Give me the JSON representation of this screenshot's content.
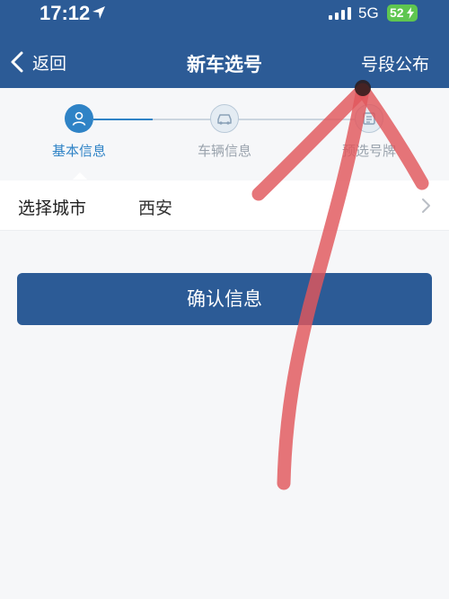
{
  "status_bar": {
    "time": "17:12",
    "network": "5G",
    "battery": "52"
  },
  "nav": {
    "back_label": "返回",
    "title": "新车选号",
    "announce_label": "号段公布"
  },
  "steps": [
    {
      "label": "基本信息",
      "state": "active",
      "icon": "user-icon"
    },
    {
      "label": "车辆信息",
      "state": "inactive",
      "icon": "car-icon"
    },
    {
      "label": "预选号牌",
      "state": "inactive",
      "icon": "plate-icon"
    }
  ],
  "city_row": {
    "label": "选择城市",
    "value": "西安"
  },
  "confirm_label": "确认信息",
  "colors": {
    "brand": "#2c5b96",
    "accent": "#2f83c6",
    "background": "#f6f7f9",
    "annotation": "#e0575c"
  }
}
